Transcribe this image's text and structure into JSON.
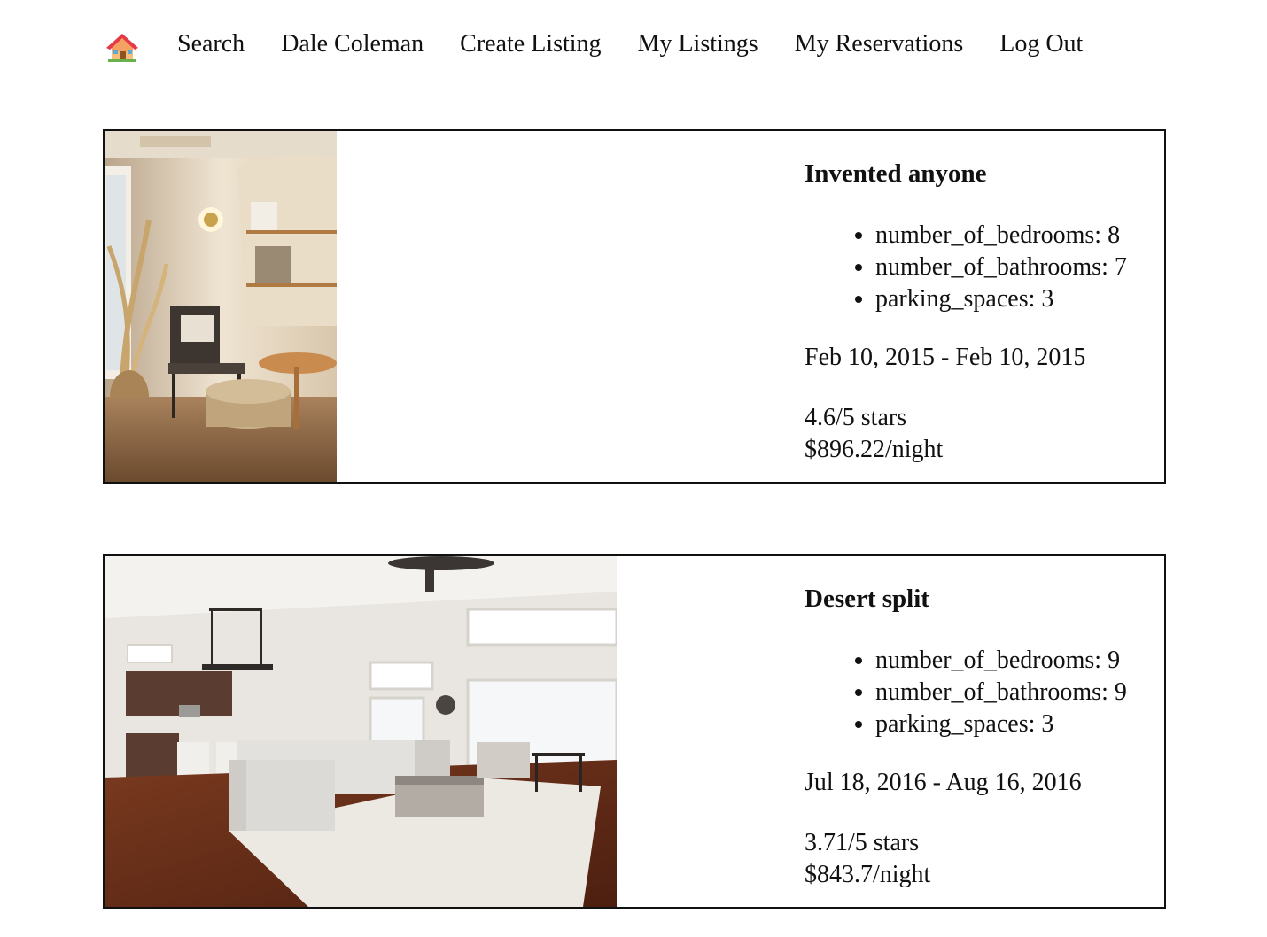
{
  "nav": {
    "home_icon": "house-emoji-icon",
    "links": [
      "Search",
      "Dale Coleman",
      "Create Listing",
      "My Listings",
      "My Reservations",
      "Log Out"
    ]
  },
  "reservations": [
    {
      "title": "Invented anyone",
      "features": [
        "number_of_bedrooms: 8",
        "number_of_bathrooms: 7",
        "parking_spaces: 3"
      ],
      "dates": "Feb 10, 2015 - Feb 10, 2015",
      "rating": "4.6/5 stars",
      "price": "$896.22/night",
      "photo": "cozy-reading-nook-photo"
    },
    {
      "title": "Desert split",
      "features": [
        "number_of_bedrooms: 9",
        "number_of_bathrooms: 9",
        "parking_spaces: 3"
      ],
      "dates": "Jul 18, 2016 - Aug 16, 2016",
      "rating": "3.71/5 stars",
      "price": "$843.7/night",
      "photo": "open-living-room-photo"
    }
  ]
}
